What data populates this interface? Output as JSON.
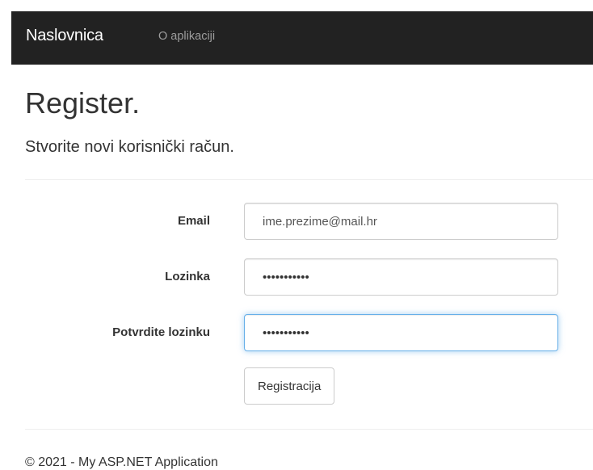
{
  "navbar": {
    "brand": "Naslovnica",
    "links": [
      "O aplikaciji"
    ],
    "background": "#222222"
  },
  "page": {
    "title": "Register.",
    "subtitle": "Stvorite novi korisnički račun."
  },
  "form": {
    "email": {
      "label": "Email",
      "value": "ime.prezime@mail.hr"
    },
    "password": {
      "label": "Lozinka",
      "value": "•••••••••••"
    },
    "confirm_password": {
      "label": "Potvrdite lozinku",
      "value": "•••••••••••"
    },
    "submit_label": "Registracija",
    "focus_color": "#66afe9"
  },
  "footer": {
    "text": "© 2021 - My ASP.NET Application"
  }
}
